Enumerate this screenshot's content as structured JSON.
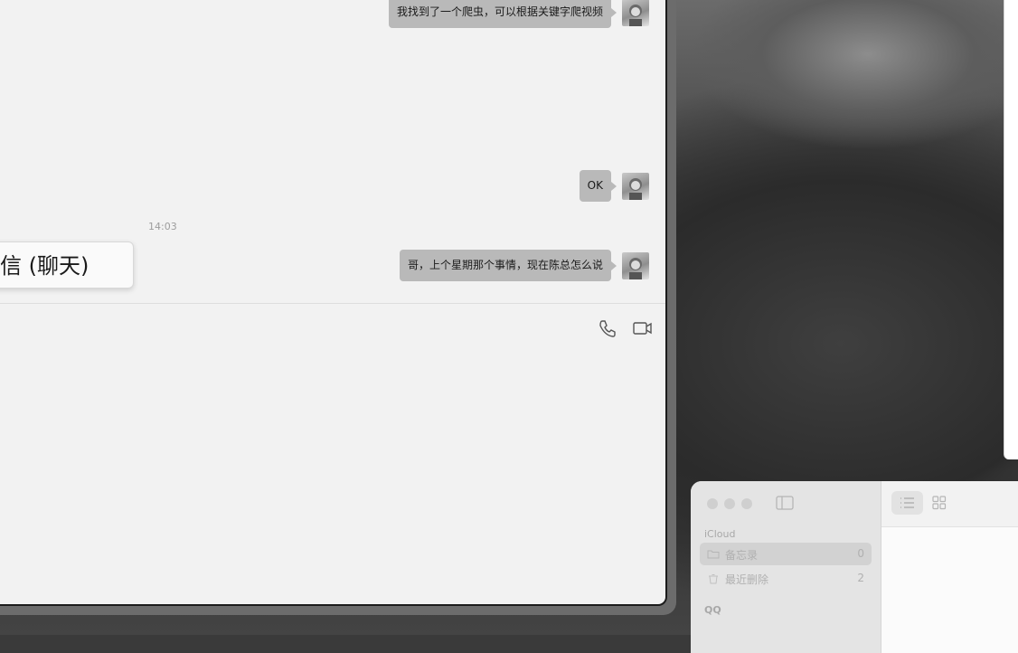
{
  "chat": {
    "messages": [
      {
        "text": "我找到了一个爬虫，可以根据关键字爬视频"
      },
      {
        "text": "OK"
      },
      {
        "text": "哥，上个星期那个事情，现在陈总怎么说"
      }
    ],
    "timestamp": "14:03",
    "tooltip": "微信 (聊天)",
    "icons": [
      "phone-icon",
      "video-call-icon"
    ]
  },
  "notes": {
    "section_icloud": "iCloud",
    "folders": [
      {
        "label": "备忘录",
        "count": "0",
        "icon": "folder-icon"
      },
      {
        "label": "最近删除",
        "count": "2",
        "icon": "trash-icon"
      }
    ],
    "section_qq": "QQ"
  }
}
